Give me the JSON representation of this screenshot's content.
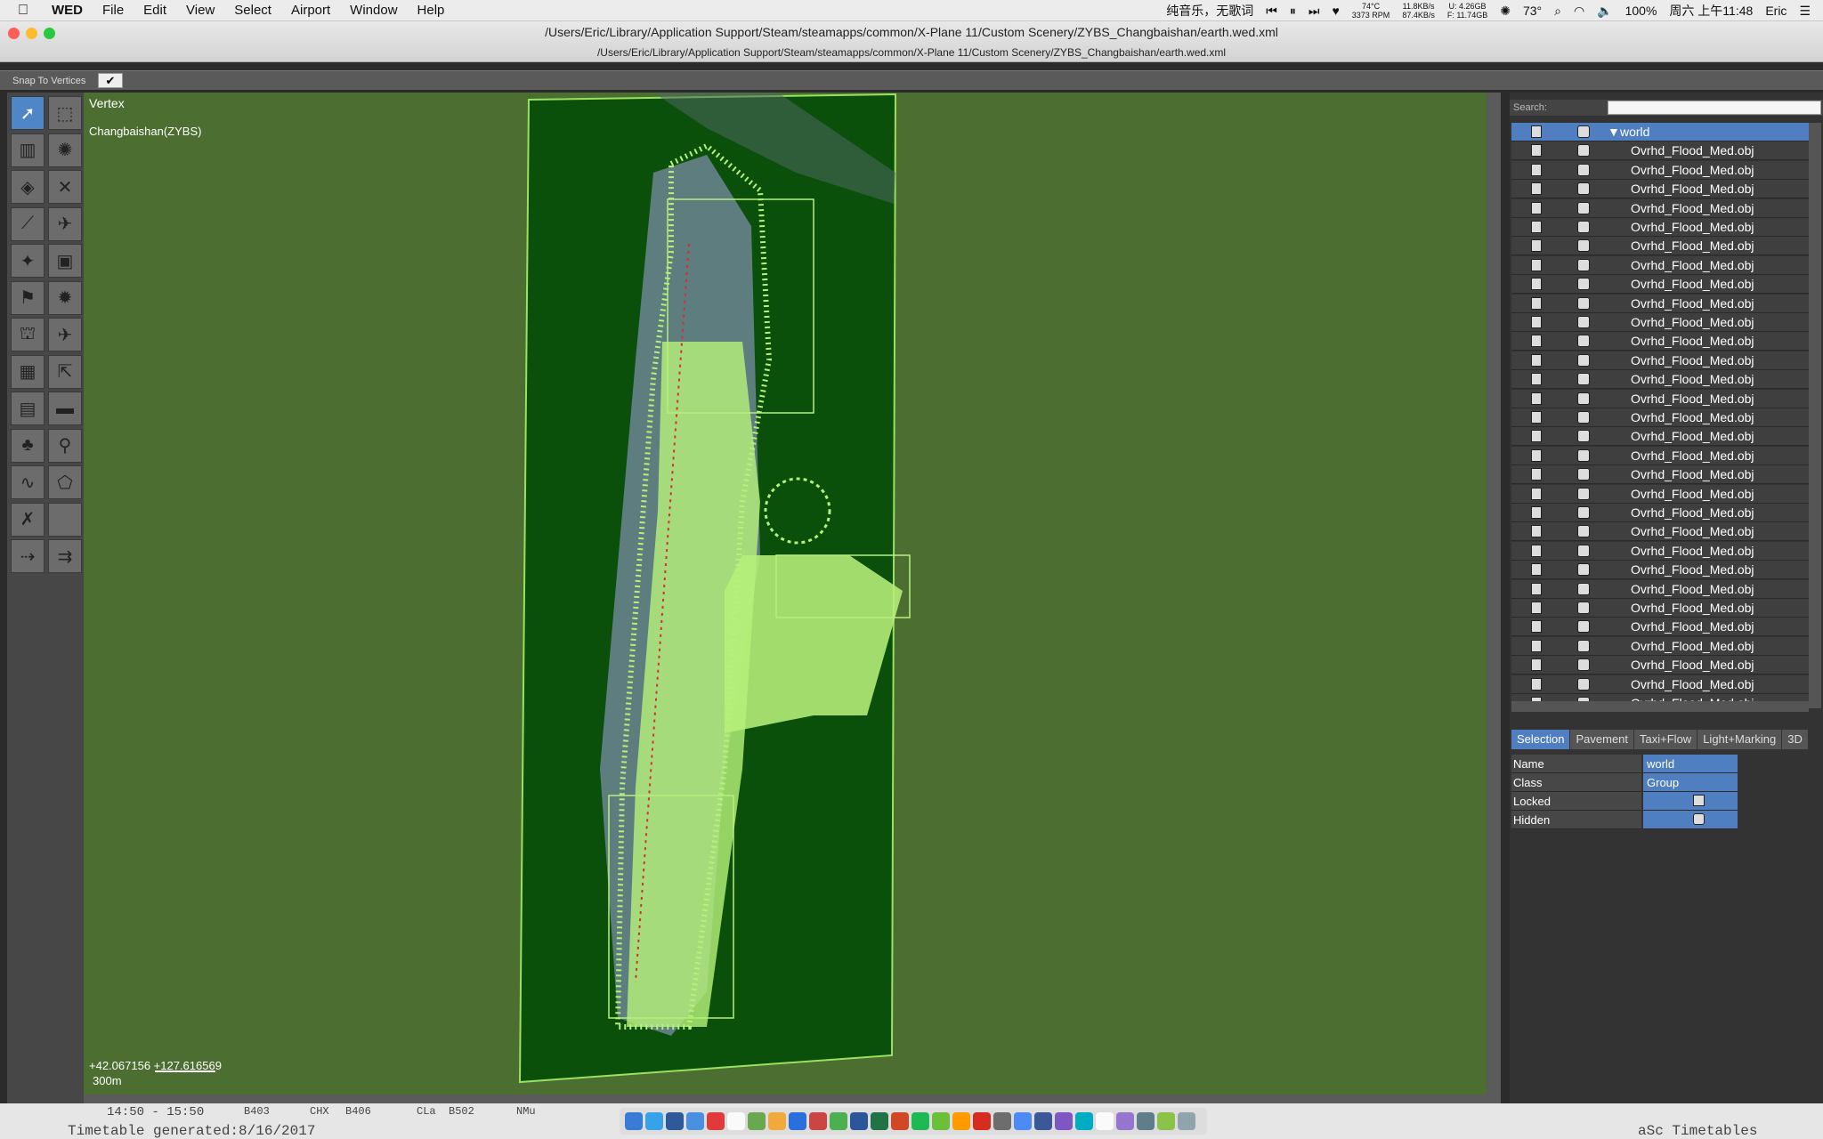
{
  "menubar": {
    "app": "WED",
    "menus": [
      "File",
      "Edit",
      "View",
      "Select",
      "Airport",
      "Window",
      "Help"
    ],
    "music": "纯音乐，无歌词",
    "cpu_temp": "74°C",
    "rpm": "3373 RPM",
    "net_up": "11.8KB/s",
    "net_down": "87.4KB/s",
    "mem_u": "U: 4.26GB",
    "mem_f": "F: 11.74GB",
    "weather": "73°",
    "battery": "100%",
    "datetime": "周六 上午11:48",
    "user": "Eric"
  },
  "window": {
    "title": "/Users/Eric/Library/Application Support/Steam/steamapps/common/X-Plane 11/Custom Scenery/ZYBS_Changbaishan/earth.wed.xml",
    "subtitle": "/Users/Eric/Library/Application Support/Steam/steamapps/common/X-Plane 11/Custom Scenery/ZYBS_Changbaishan/earth.wed.xml"
  },
  "snap": {
    "label": "Snap To Vertices",
    "check": "✔"
  },
  "tools": [
    {
      "name": "vertex-tool",
      "glyph": "➚",
      "active": true
    },
    {
      "name": "marquee-tool",
      "glyph": "⬚"
    },
    {
      "name": "runway-tool",
      "glyph": "▥"
    },
    {
      "name": "helipad-tool",
      "glyph": "✺"
    },
    {
      "name": "sealane-tool",
      "glyph": "◈"
    },
    {
      "name": "crossed-runway-tool",
      "glyph": "✕"
    },
    {
      "name": "taxiway-tool",
      "glyph": "⟋"
    },
    {
      "name": "ramp-tool",
      "glyph": "✈"
    },
    {
      "name": "light-tool",
      "glyph": "✦"
    },
    {
      "name": "sign-tool",
      "glyph": "▣"
    },
    {
      "name": "windsock-tool",
      "glyph": "⚑"
    },
    {
      "name": "beacon-tool",
      "glyph": "✹"
    },
    {
      "name": "tower-tool",
      "glyph": "⛫"
    },
    {
      "name": "plane-tool",
      "glyph": "✈"
    },
    {
      "name": "facade-tool",
      "glyph": "▦"
    },
    {
      "name": "atc-tool",
      "glyph": "⇱"
    },
    {
      "name": "building-tool",
      "glyph": "▤"
    },
    {
      "name": "forest-line-tool",
      "glyph": "▬"
    },
    {
      "name": "tree-tool",
      "glyph": "♣"
    },
    {
      "name": "line-tool",
      "glyph": "⚲"
    },
    {
      "name": "polyline-tool",
      "glyph": "∿"
    },
    {
      "name": "polygon-tool",
      "glyph": "⬠"
    },
    {
      "name": "exclusion-tool",
      "glyph": "✗"
    },
    {
      "name": "blank-tool",
      "glyph": ""
    },
    {
      "name": "route-tool",
      "glyph": "⇢"
    },
    {
      "name": "edge-tool",
      "glyph": "⇉"
    }
  ],
  "map": {
    "mode": "Vertex",
    "airport": "Changbaishan(ZYBS)",
    "coords": "+42.067156 +127.616569",
    "scale": "300m"
  },
  "hierarchy": {
    "search_label": "Search:",
    "search_value": "",
    "root": "world",
    "items": [
      "Ovrhd_Flood_Med.obj",
      "Ovrhd_Flood_Med.obj",
      "Ovrhd_Flood_Med.obj",
      "Ovrhd_Flood_Med.obj",
      "Ovrhd_Flood_Med.obj",
      "Ovrhd_Flood_Med.obj",
      "Ovrhd_Flood_Med.obj",
      "Ovrhd_Flood_Med.obj",
      "Ovrhd_Flood_Med.obj",
      "Ovrhd_Flood_Med.obj",
      "Ovrhd_Flood_Med.obj",
      "Ovrhd_Flood_Med.obj",
      "Ovrhd_Flood_Med.obj",
      "Ovrhd_Flood_Med.obj",
      "Ovrhd_Flood_Med.obj",
      "Ovrhd_Flood_Med.obj",
      "Ovrhd_Flood_Med.obj",
      "Ovrhd_Flood_Med.obj",
      "Ovrhd_Flood_Med.obj",
      "Ovrhd_Flood_Med.obj",
      "Ovrhd_Flood_Med.obj",
      "Ovrhd_Flood_Med.obj",
      "Ovrhd_Flood_Med.obj",
      "Ovrhd_Flood_Med.obj",
      "Ovrhd_Flood_Med.obj",
      "Ovrhd_Flood_Med.obj",
      "Ovrhd_Flood_Med.obj",
      "Ovrhd_Flood_Med.obj",
      "Ovrhd_Flood_Med.obj",
      "Ovrhd_Flood_Med.obj"
    ]
  },
  "tabs": [
    "Selection",
    "Pavement",
    "Taxi+Flow",
    "Light+Marking",
    "3D"
  ],
  "properties": [
    {
      "key": "Name",
      "value": "world"
    },
    {
      "key": "Class",
      "value": "Group"
    },
    {
      "key": "Locked",
      "value": "",
      "icon": "lock-icon"
    },
    {
      "key": "Hidden",
      "value": "",
      "icon": "eye-icon"
    }
  ],
  "bottom": {
    "time": "14:50 - 15:50",
    "codes": [
      "B403",
      "CHX",
      "B406",
      "CLa",
      "B502",
      "NMu"
    ],
    "left_text": "Timetable generated:8/16/2017",
    "right_text": "aSc Timetables"
  },
  "colors": {
    "map_bg": "#4c6e30",
    "airport_bg": "#0a4f0a",
    "overlay": "#b6f07a",
    "selection": "#4f7fc0"
  }
}
